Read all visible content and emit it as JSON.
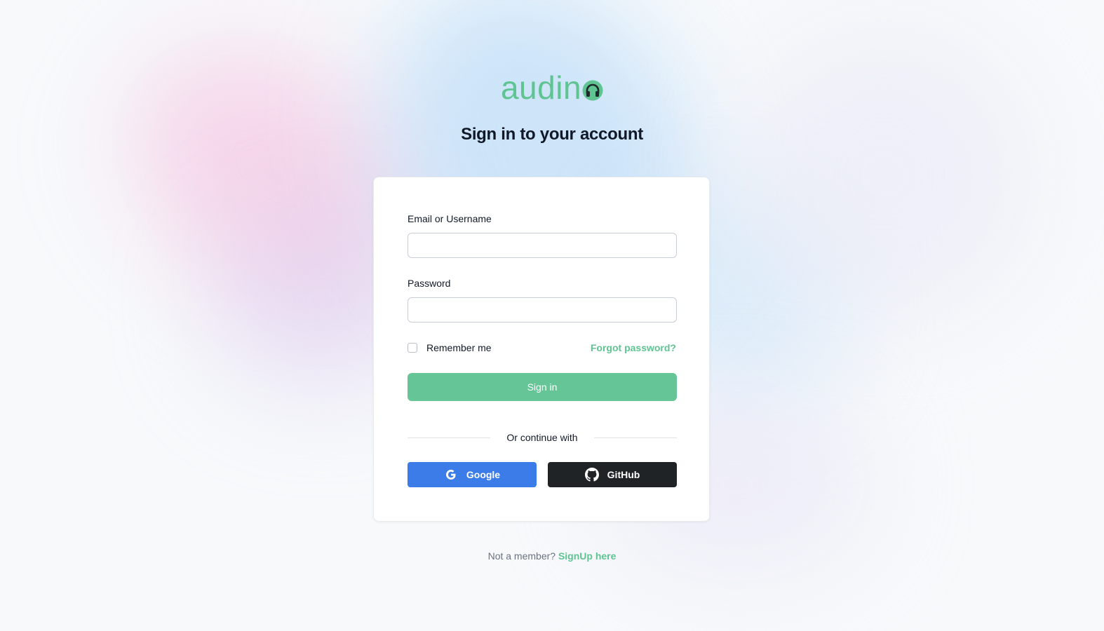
{
  "brand": {
    "name": "audin",
    "logo_icon": "headphones-icon",
    "accent_color": "#5fc492"
  },
  "page": {
    "heading": "Sign in to your account"
  },
  "form": {
    "email_label": "Email or Username",
    "email_value": "",
    "password_label": "Password",
    "password_value": "",
    "remember_label": "Remember me",
    "remember_checked": false,
    "forgot_label": "Forgot password?",
    "submit_label": "Sign in",
    "submit_color": "#66c596"
  },
  "social": {
    "divider_text": "Or continue with",
    "google_label": "Google",
    "google_icon": "google-icon",
    "google_color": "#3b7ce8",
    "github_label": "GitHub",
    "github_icon": "github-icon",
    "github_color": "#202326"
  },
  "footer": {
    "prompt": "Not a member?",
    "signup_label": "SignUp here"
  }
}
